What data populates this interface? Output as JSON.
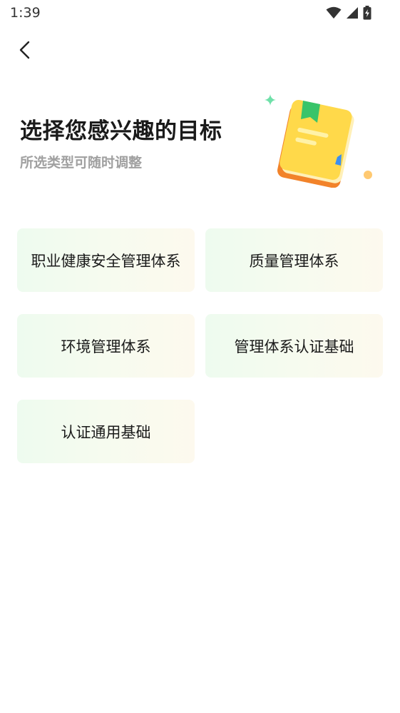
{
  "status_bar": {
    "time": "1:39"
  },
  "nav": {
    "back_icon": "chevron-left-icon"
  },
  "header": {
    "title": "选择您感兴趣的目标",
    "subtitle": "所选类型可随时调整"
  },
  "options": [
    {
      "label": "职业健康安全管理体系"
    },
    {
      "label": "质量管理体系"
    },
    {
      "label": "环境管理体系"
    },
    {
      "label": "管理体系认证基础"
    },
    {
      "label": "认证通用基础"
    }
  ],
  "colors": {
    "card_gradient_start": "#eefbef",
    "card_gradient_end": "#fdf9ee",
    "subtitle": "#a0a0a0",
    "book_orange": "#f58a2a",
    "book_yellow": "#ffd94a",
    "bookmark_green": "#39c46a"
  }
}
